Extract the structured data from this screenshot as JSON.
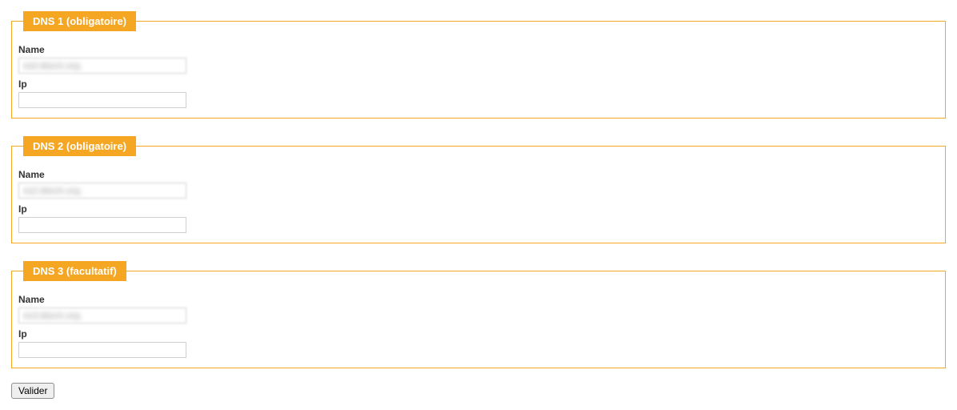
{
  "dns_sections": [
    {
      "legend": "DNS 1 (obligatoire)",
      "name_label": "Name",
      "name_value": "ns0.titech.org",
      "ip_label": "Ip",
      "ip_value": ""
    },
    {
      "legend": "DNS 2 (obligatoire)",
      "name_label": "Name",
      "name_value": "ns2.titech.org",
      "ip_label": "Ip",
      "ip_value": ""
    },
    {
      "legend": "DNS 3 (facultatif)",
      "name_label": "Name",
      "name_value": "ns3.titech.org",
      "ip_label": "Ip",
      "ip_value": ""
    }
  ],
  "submit_label": "Valider"
}
